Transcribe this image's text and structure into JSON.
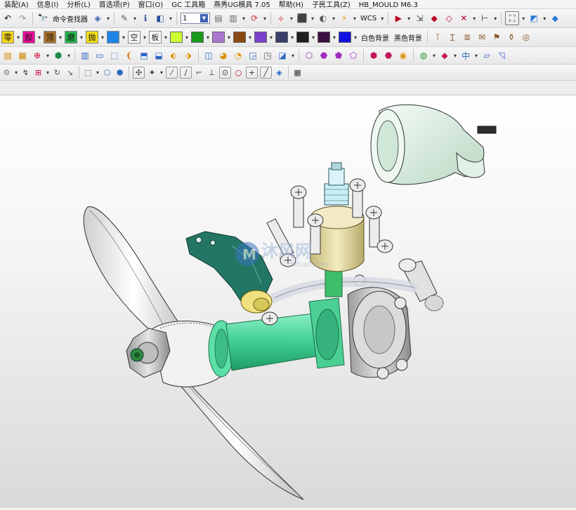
{
  "menubar": {
    "items": [
      "装配(A)",
      "信息(I)",
      "分析(L)",
      "首选项(P)",
      "窗口(O)",
      "GC 工具箱",
      "燕秀UG模具 7.05",
      "帮助(H)",
      "子民工具(Z)",
      "HB_MOULD M6.3"
    ]
  },
  "toolbar1": {
    "command_finder_label": "命令查找器",
    "layer_value": "1",
    "wcs_label": "WCS"
  },
  "toolbar2": {
    "chips": [
      {
        "text": "零",
        "bg": "#f1d21a"
      },
      {
        "text": "胶",
        "bg": "#e6109a"
      },
      {
        "text": "顶",
        "bg": "#a8702c"
      },
      {
        "text": "磨",
        "bg": "#23b24a"
      },
      {
        "text": "抛",
        "bg": "#f3df18"
      },
      {
        "text": "",
        "bg": "#1f84e6"
      },
      {
        "text": "空",
        "bg": "#ffffff"
      },
      {
        "text": "板",
        "bg": "#ffffff"
      }
    ],
    "swatches": [
      "#ccff33",
      "#1a9a1a",
      "#a978cf",
      "#8a4a12",
      "#7a42cc",
      "#3a3f6a",
      "#1f1f1f",
      "#3a1040",
      "#1010e0"
    ],
    "white_bg_label": "白色背景",
    "black_bg_label": "黑色背景"
  },
  "viewport": {
    "watermark_text": "沐风网",
    "watermark_url": "mfcad.com"
  },
  "colors": {
    "accent_blue": "#1f84e6",
    "bracket_green": "#1f6f5c",
    "cylinder_green": "#43d89a",
    "yellow_part": "#e8dca0"
  }
}
